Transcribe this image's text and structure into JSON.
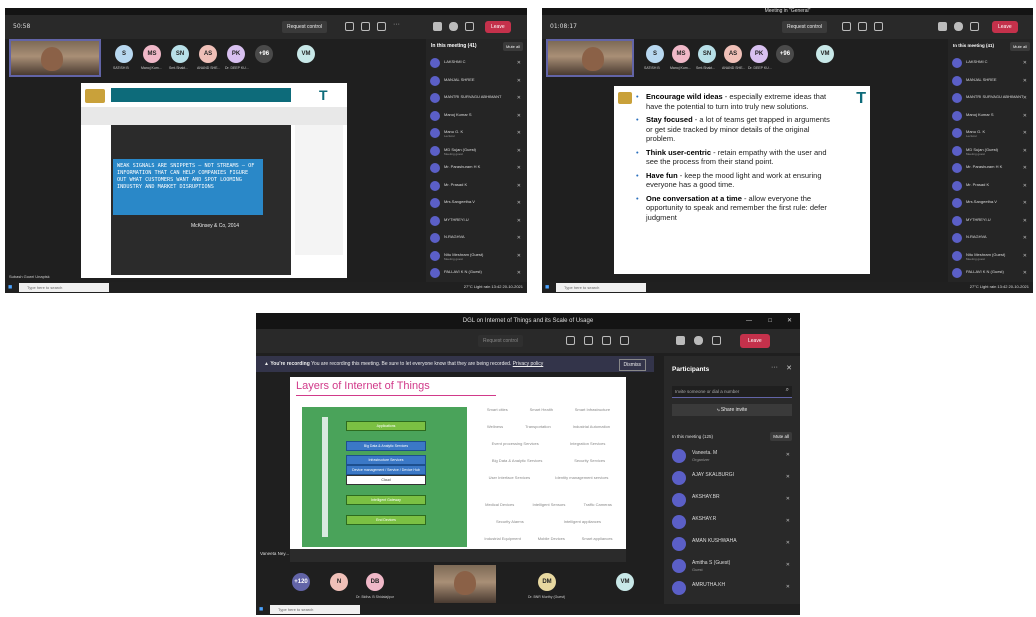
{
  "shot1": {
    "timer": "50:58",
    "request_control": "Request control",
    "leave": "Leave",
    "participants": [
      {
        "i": "S",
        "n": "SATISH B",
        "c": "#b8d8f0"
      },
      {
        "i": "MS",
        "n": "Manoj Kum...",
        "c": "#f0b8c8"
      },
      {
        "i": "SN",
        "n": "Smt.Shakt...",
        "c": "#b8e0e8"
      },
      {
        "i": "AS",
        "n": "ANAND SHE...",
        "c": "#f0c0b8"
      },
      {
        "i": "PK",
        "n": "Dr. DEEP KU...",
        "c": "#d8c0f0"
      },
      {
        "i": "+96",
        "n": "",
        "c": "#4a4a4a"
      },
      {
        "i": "VM",
        "n": "",
        "c": "#c8e8e8"
      }
    ],
    "panel_title": "In this meeting (41)",
    "mute_all": "Mute all",
    "panel_people": [
      "LAKSHMI C",
      "MANJAL SHREE",
      "MANTRI SURVAGU ABHIMANT",
      "Manoj Kumar S",
      "Manu G. K",
      "MD Sujan (Guest)",
      "Mr. Parashuram H K",
      "Mr. Prasad K",
      "Mrs.Sangeetha.V",
      "MYTHREYI.U",
      "N.RAGHVA",
      "Nitu Meshram (Guest)",
      "PALLAVI K N (Guest)"
    ],
    "panel_subs": [
      "",
      "",
      "",
      "",
      "Lecturer",
      "Meeting guest",
      "",
      "",
      "",
      "",
      "",
      "Meeting guest",
      ""
    ],
    "slide_quote": "WEAK SIGNALS ARE SNIPPETS – NOT STREAMS – OF INFORMATION THAT CAN HELP COMPANIES FIGURE OUT WHAT CUSTOMERS WANT AND SPOT LOOMING INDUSTRY AND MARKET DISRUPTIONS",
    "slide_credit": "McKinsey & Co, 2014",
    "presenter": "Subash Gowri Unapisk",
    "search": "Type here to search",
    "tray": "27°C Light rain  13:42 20-10-2021"
  },
  "shot2": {
    "title": "Meeting in \"General\"",
    "timer": "01:08:17",
    "request_control": "Request control",
    "leave": "Leave",
    "panel_title": "In this meeting (41)",
    "mute_all": "Mute all",
    "bullets": [
      {
        "b": "Encourage wild ideas",
        "t": " - especially extreme ideas that have the potential to turn into truly new solutions."
      },
      {
        "b": "Stay focused",
        "t": " - a lot of teams get trapped in arguments or get side tracked by minor details of the original problem."
      },
      {
        "b": "Think user-centric",
        "t": " - retain empathy with the user and see the process from their stand point."
      },
      {
        "b": "Have fun",
        "t": " - keep the mood light and work at ensuring everyone has a good time."
      },
      {
        "b": "One conversation at a time",
        "t": " - allow everyone the opportunity to speak and remember the first rule: defer judgment"
      }
    ]
  },
  "shot3": {
    "title": "DGL on Internet of Things and its Scale of Usage",
    "request_control": "Request control",
    "leave": "Leave",
    "recording_bold": "You're recording",
    "recording_text": "You are recording this meeting. Be sure to let everyone know that they are being recorded.",
    "privacy": "Privacy policy",
    "dismiss": "Dismiss",
    "slide_title": "Layers of Internet of Things",
    "layers": [
      "Applications",
      "Big Data & Analytic Services",
      "Infrastructure Services",
      "Device management / Service / Device Hub",
      "Cloud",
      "Intelligent Gateway",
      "End Devices"
    ],
    "services": [
      [
        "Smart cities",
        "Smart Health",
        "Smart Infrastructure"
      ],
      [
        "Wellness",
        "Transportation",
        "Industrial Automation"
      ],
      [
        "Event processing Services",
        "Integration Services"
      ],
      [
        "Big Data & Analytic Services",
        "Security Services"
      ],
      [
        "User Interface Services",
        "Identity management services"
      ],
      [
        "Medical Devices",
        "Intelligent Sensors",
        "Traffic Cameras"
      ],
      [
        "Security Alarms",
        "Intelligent appliances"
      ],
      [
        "Industrial Equipment",
        "Mobile Devices",
        "Smart appliances"
      ]
    ],
    "participants_header": "Participants",
    "invite_placeholder": "Invite someone or dial a number",
    "share_invite": "Share invite",
    "meeting_count": "In this meeting (125)",
    "mute_all": "Mute all",
    "people": [
      {
        "n": "Vaneeta. M",
        "s": "Organizer"
      },
      {
        "n": "AJAY SKALBURGI",
        "s": ""
      },
      {
        "n": "AKSHAY.BR",
        "s": ""
      },
      {
        "n": "AKSHAY.R",
        "s": ""
      },
      {
        "n": "AMAN KUSHWAHA",
        "s": ""
      },
      {
        "n": "Amitha S (Guest)",
        "s": "Guest"
      },
      {
        "n": "AMRUTHA.KH",
        "s": ""
      }
    ],
    "bottom": [
      {
        "i": "+120",
        "n": "",
        "c": "#6264a7"
      },
      {
        "i": "N",
        "n": "",
        "c": "#f0c0b8"
      },
      {
        "i": "DB",
        "n": "Dr. Bidha. B Shidalajipur",
        "c": "#f0b8c8"
      },
      {
        "i": "DM",
        "n": "Dr. BNR Murthy (Guest)",
        "c": "#e8d8a0"
      },
      {
        "i": "VM",
        "n": "",
        "c": "#c8e8e8"
      }
    ],
    "presenter": "Vaneeta Ney...",
    "search": "Type here to search"
  }
}
